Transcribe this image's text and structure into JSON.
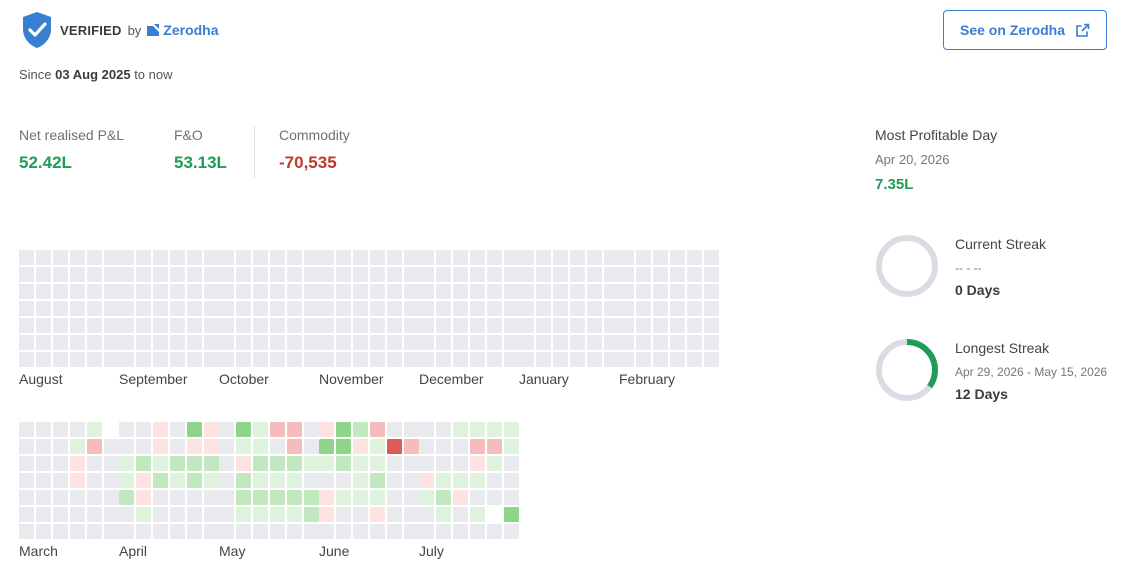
{
  "header": {
    "verified": "VERIFIED",
    "by": "by",
    "broker": "Zerodha",
    "see_button": "See on Zerodha"
  },
  "since": {
    "prefix": "Since",
    "date": "03 Aug 2025",
    "suffix": "to now"
  },
  "stats": [
    {
      "label": "Net realised P&L",
      "value": "52.42L",
      "sign": "positive"
    },
    {
      "label": "F&O",
      "value": "53.13L",
      "sign": "positive"
    },
    {
      "label": "Commodity",
      "value": "-70,535",
      "sign": "negative"
    }
  ],
  "most_profitable_day": {
    "label": "Most Profitable Day",
    "date": "Apr 20, 2026",
    "value": "7.35L"
  },
  "current_streak": {
    "label": "Current Streak",
    "dates": "-- - --",
    "days": "0 Days",
    "progress": 0
  },
  "longest_streak": {
    "label": "Longest Streak",
    "dates": "Apr 29, 2026 - May 15, 2026",
    "days": "12 Days",
    "progress": 0.35
  },
  "colors": {
    "empty": "#e8eaee",
    "profit_1": "#dff2dd",
    "profit_2": "#c2e8bf",
    "profit_3": "#8fd48b",
    "profit_4": "#56b85a",
    "loss_1": "#fde2e2",
    "loss_2": "#f6bcbc",
    "loss_3": "#e05a5a",
    "accent_blue": "#387ed1",
    "ring_track": "#d9dde3",
    "ring_fill": "#1f9d55"
  },
  "months": [
    {
      "name": "August",
      "cells": [
        "000000",
        "000000",
        "000000",
        "000000",
        "000000",
        "000000",
        "000000"
      ]
    },
    {
      "name": "September",
      "cells": [
        "000000",
        "000000",
        "000000",
        "000000",
        "000000",
        "000000",
        "000000"
      ]
    },
    {
      "name": "October",
      "cells": [
        "000000",
        "000000",
        "000000",
        "000000",
        "000000",
        "000000",
        "000000"
      ]
    },
    {
      "name": "November",
      "cells": [
        "000000",
        "000000",
        "000000",
        "000000",
        "000000",
        "000000",
        "000000"
      ]
    },
    {
      "name": "December",
      "cells": [
        "000000",
        "000000",
        "000000",
        "000000",
        "000000",
        "000000",
        "000000"
      ]
    },
    {
      "name": "January",
      "cells": [
        "000000",
        "000000",
        "000000",
        "000000",
        "000000",
        "000000",
        "000000"
      ]
    },
    {
      "name": "February",
      "cells": [
        "000000",
        "000000",
        "000000",
        "000000",
        "000000",
        "000000",
        "000000"
      ]
    },
    {
      "name": "March",
      "cells": [
        "00001 ",
        "0001b0",
        "000a00",
        "000a00",
        "000000",
        "000000",
        "000000"
      ]
    },
    {
      "name": "April",
      "cells": [
        "00a03a",
        "00a0aa",
        "121222",
        "1a2121",
        "2a0000",
        "010000",
        "000000"
      ]
    },
    {
      "name": "May",
      "cells": [
        "031bb0",
        "0110b0",
        "0a2221",
        "021110",
        "022222",
        "011112",
        "000000"
      ]
    },
    {
      "name": "June",
      "cells": [
        "a32b00",
        "33a1db",
        "121100",
        "001200",
        "a11100",
        "a00a00",
        "000000"
      ]
    },
    {
      "name": "July",
      "cells": [
        "001111b",
        "000bb1",
        "000a10",
        "a11100",
        "12a000",
        "0101 3",
        "000000"
      ]
    }
  ]
}
